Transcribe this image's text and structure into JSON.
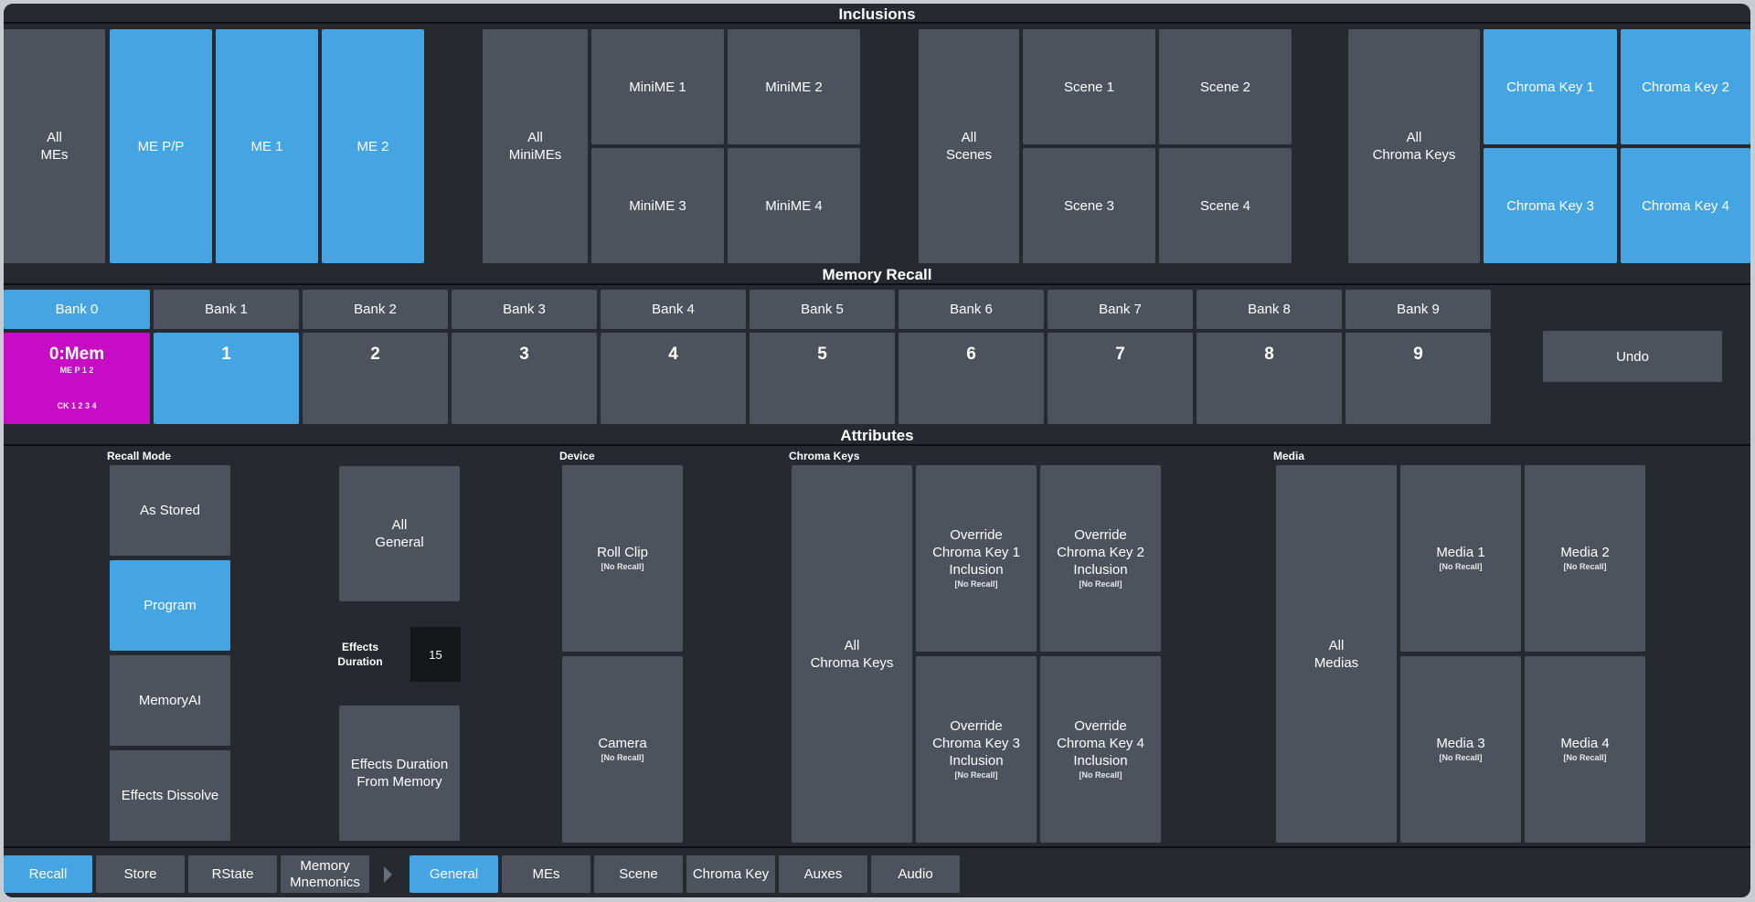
{
  "inclusions": {
    "title": "Inclusions",
    "all_mes": "All\nMEs",
    "mes": [
      "ME P/P",
      "ME 1",
      "ME 2"
    ],
    "all_minimes": "All\nMiniMEs",
    "minimes": [
      "MiniME 1",
      "MiniME 2",
      "MiniME 3",
      "MiniME 4"
    ],
    "all_scenes": "All\nScenes",
    "scenes": [
      "Scene 1",
      "Scene 2",
      "Scene 3",
      "Scene 4"
    ],
    "all_chroma": "All\nChroma Keys",
    "chroma": [
      "Chroma Key 1",
      "Chroma Key 2",
      "Chroma Key 3",
      "Chroma Key 4"
    ]
  },
  "memory_recall": {
    "title": "Memory Recall",
    "banks": [
      "Bank 0",
      "Bank 1",
      "Bank 2",
      "Bank 3",
      "Bank 4",
      "Bank 5",
      "Bank 6",
      "Bank 7",
      "Bank 8",
      "Bank 9"
    ],
    "mem0": {
      "title": "0:Mem",
      "line1": "ME P 1 2",
      "line2": "CK 1 2 3 4"
    },
    "slots": [
      "1",
      "2",
      "3",
      "4",
      "5",
      "6",
      "7",
      "8",
      "9"
    ],
    "undo": "Undo"
  },
  "attributes": {
    "title": "Attributes",
    "recall_mode": {
      "label": "Recall Mode",
      "options": [
        "As Stored",
        "Program",
        "MemoryAI",
        "Effects Dissolve"
      ]
    },
    "all_general": "All\nGeneral",
    "effects_duration": {
      "label": "Effects\nDuration",
      "value": "15"
    },
    "effects_from_memory": "Effects Duration\nFrom Memory",
    "device": {
      "label": "Device",
      "roll_clip": "Roll Clip",
      "camera": "Camera",
      "no_recall": "[No Recall]"
    },
    "chroma_keys": {
      "label": "Chroma Keys",
      "all": "All\nChroma Keys",
      "overrides": [
        "Override\nChroma Key 1\nInclusion",
        "Override\nChroma Key 2\nInclusion",
        "Override\nChroma Key 3\nInclusion",
        "Override\nChroma Key 4\nInclusion"
      ],
      "no_recall": "[No Recall]"
    },
    "media": {
      "label": "Media",
      "all": "All\nMedias",
      "items": [
        "Media 1",
        "Media 2",
        "Media 3",
        "Media 4"
      ],
      "no_recall": "[No Recall]"
    }
  },
  "tabs": {
    "left": [
      "Recall",
      "Store",
      "RState",
      "Memory\nMnemonics"
    ],
    "right": [
      "General",
      "MEs",
      "Scene",
      "Chroma Key",
      "Auxes",
      "Audio"
    ]
  },
  "colors": {
    "accent": "#44a5e2",
    "button": "#4d525d",
    "background": "#262a30",
    "mem_active": "#c60cc4"
  }
}
